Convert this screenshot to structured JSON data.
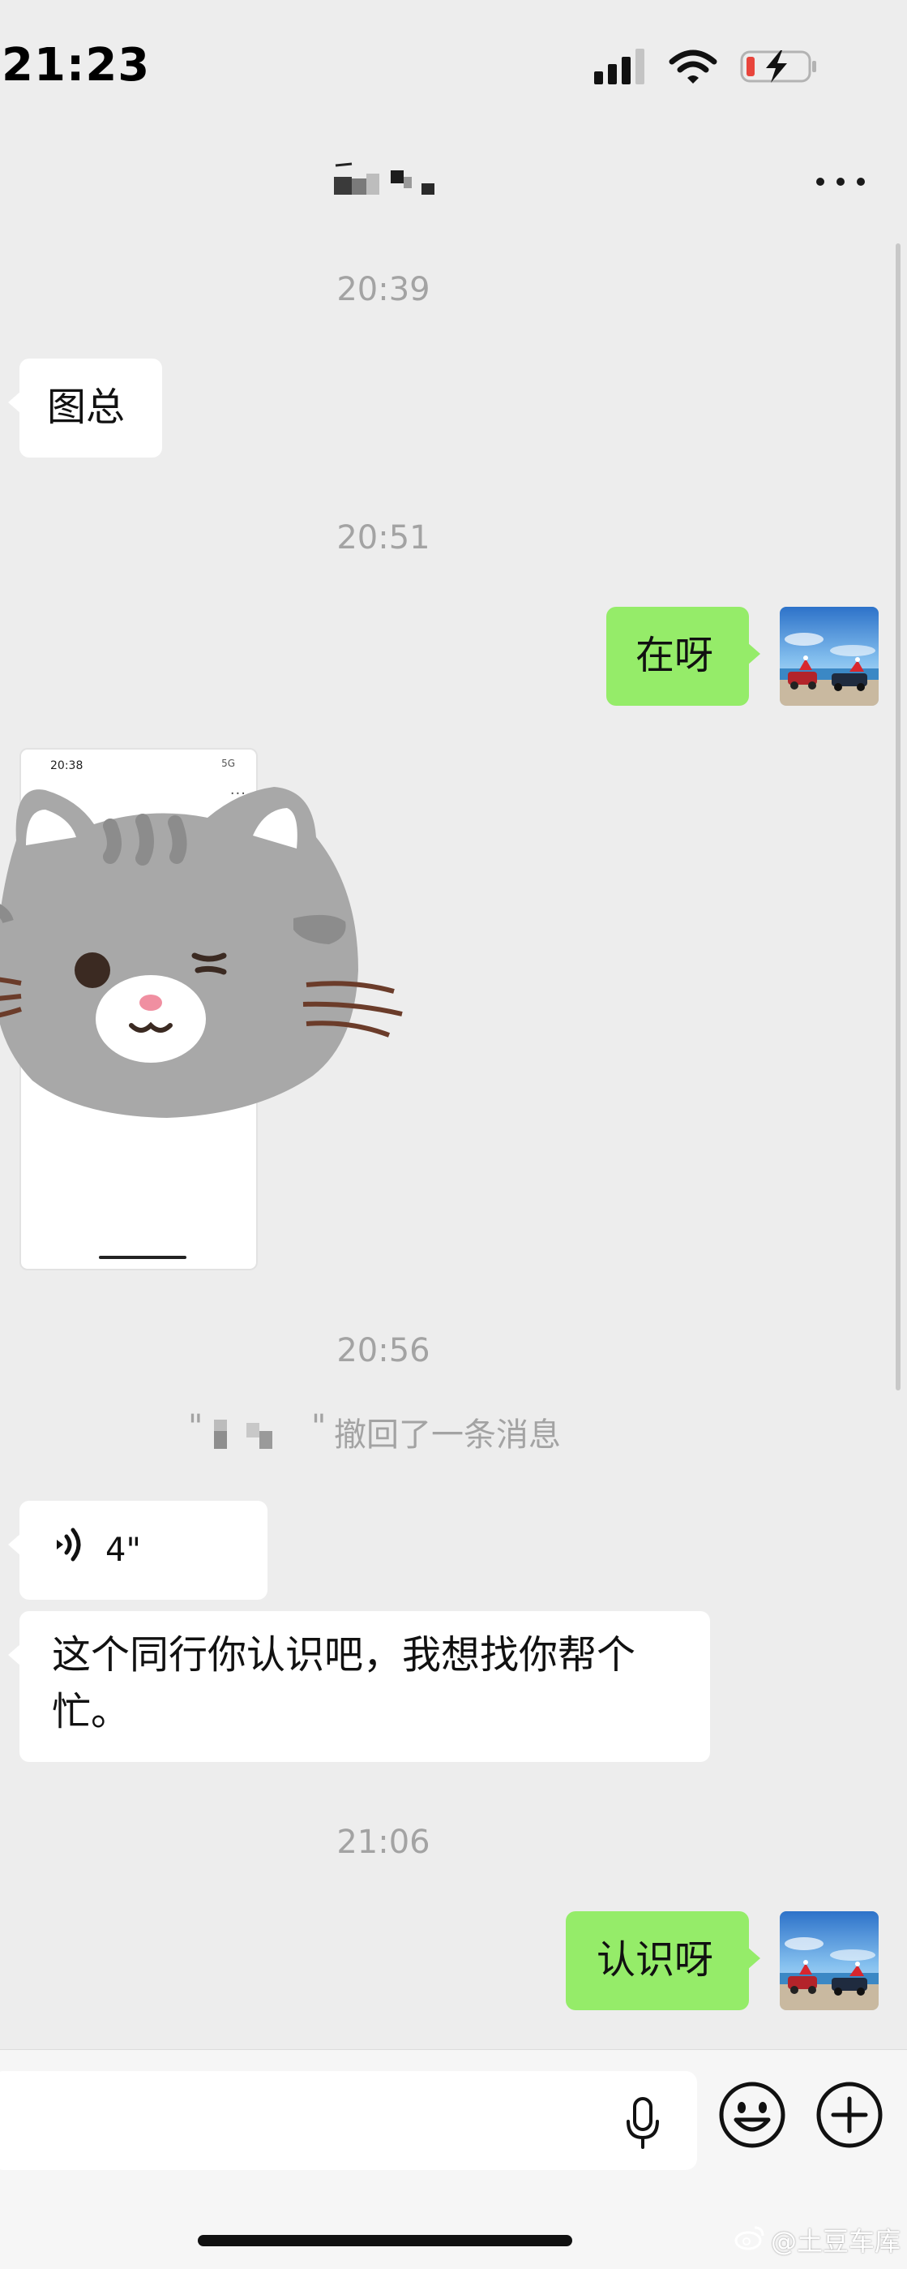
{
  "status_bar": {
    "time": "21:23"
  },
  "messages": {
    "ts_1": "20:39",
    "msg_1": "图总",
    "ts_2": "20:51",
    "msg_2": "在呀",
    "ts_3": "20:56",
    "recall_text": "撤回了一条消息",
    "voice_duration": "4\"",
    "msg_3": "这个同行你认识吧，我想找你帮个忙。",
    "ts_4": "21:06",
    "msg_4": "认识呀"
  },
  "shared_card": {
    "time": "20:38",
    "status": "5G"
  },
  "input": {
    "value": ""
  },
  "watermark": "@土豆车库",
  "colors": {
    "background": "#ededed",
    "incoming_bubble": "#ffffff",
    "outgoing_bubble": "#95ec69",
    "timestamp": "#a3a3a3"
  },
  "icons": [
    "signal-icon",
    "wifi-icon",
    "battery-charging-icon",
    "more-icon",
    "voice-wave-icon",
    "microphone-icon",
    "emoji-icon",
    "plus-icon",
    "weibo-icon"
  ]
}
